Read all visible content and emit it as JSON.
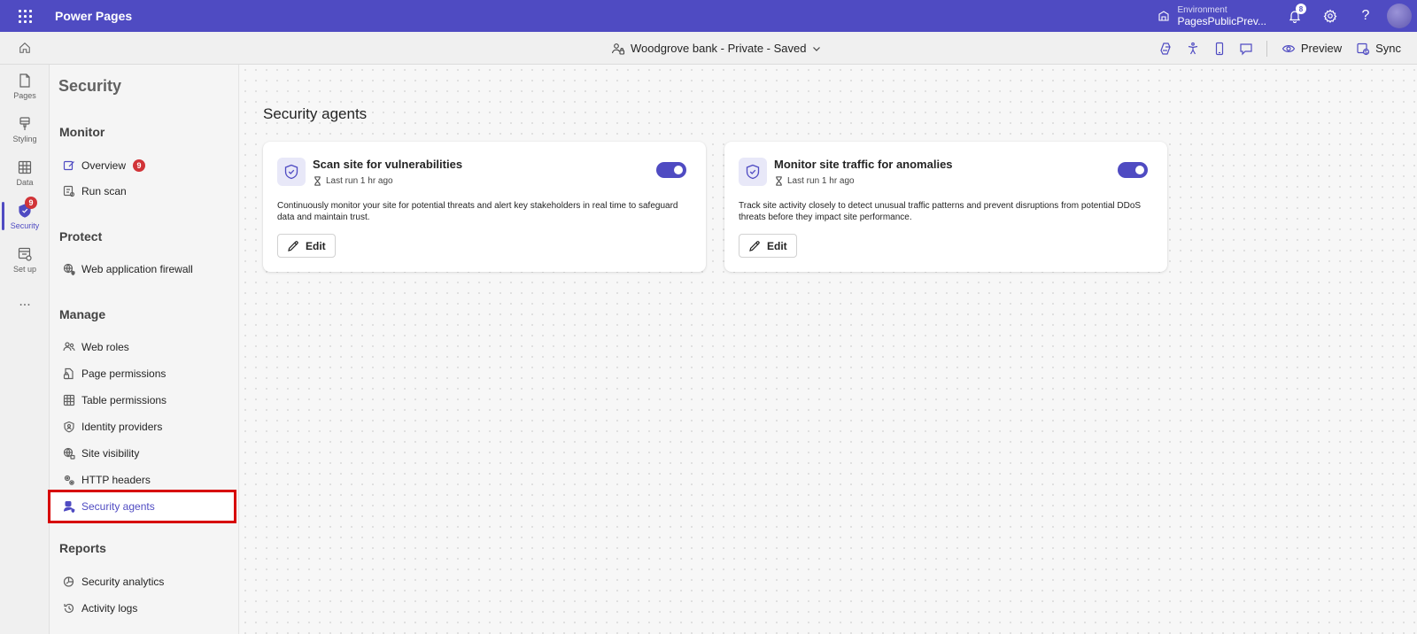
{
  "header": {
    "app_title": "Power Pages",
    "environment_label": "Environment",
    "environment_name": "PagesPublicPrev...",
    "notification_count": "8",
    "brand_color": "#4f4bc2"
  },
  "command_bar": {
    "site_name": "Woodgrove bank - Private - Saved",
    "preview_label": "Preview",
    "sync_label": "Sync"
  },
  "rail": {
    "items": [
      {
        "label": "Pages",
        "icon": "page-icon"
      },
      {
        "label": "Styling",
        "icon": "brush-icon"
      },
      {
        "label": "Data",
        "icon": "table-icon"
      },
      {
        "label": "Security",
        "icon": "shield-icon",
        "badge": "9"
      },
      {
        "label": "Set up",
        "icon": "setup-icon"
      }
    ],
    "more": "..."
  },
  "subnav": {
    "title": "Security",
    "sections": {
      "monitor": "Monitor",
      "protect": "Protect",
      "manage": "Manage",
      "reports": "Reports"
    },
    "items": {
      "overview": "Overview",
      "overview_badge": "9",
      "run_scan": "Run scan",
      "waf": "Web application firewall",
      "web_roles": "Web roles",
      "page_permissions": "Page permissions",
      "table_permissions": "Table permissions",
      "identity_providers": "Identity providers",
      "site_visibility": "Site visibility",
      "http_headers": "HTTP headers",
      "security_agents": "Security agents",
      "security_analytics": "Security analytics",
      "activity_logs": "Activity logs"
    }
  },
  "main": {
    "title": "Security agents",
    "cards": [
      {
        "title": "Scan site for vulnerabilities",
        "meta": "Last run 1 hr ago",
        "description": "Continuously monitor your site for potential threats and alert key stakeholders in real time to safeguard data and maintain trust.",
        "edit_label": "Edit",
        "enabled": true
      },
      {
        "title": "Monitor site traffic for anomalies",
        "meta": "Last run 1 hr ago",
        "description": "Track site activity closely to detect unusual traffic patterns and prevent disruptions from potential DDoS threats before they impact site performance.",
        "edit_label": "Edit",
        "enabled": true
      }
    ]
  }
}
